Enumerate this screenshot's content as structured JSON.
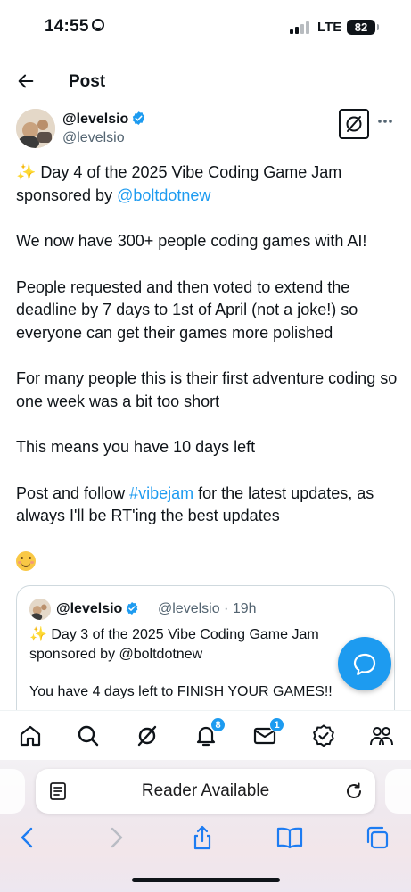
{
  "status_bar": {
    "time": "14:55",
    "network": "LTE",
    "battery": "82"
  },
  "header": {
    "title": "Post"
  },
  "author": {
    "name": "@levelsio",
    "handle": "@levelsio"
  },
  "post": {
    "line1_text": " Day 4 of the 2025 Vibe Coding Game Jam",
    "line2_prefix": "sponsored by ",
    "line2_link": "@boltdotnew",
    "p2": "We now have 300+ people coding games with AI!",
    "p3": "People requested and then voted to extend the deadline by 7 days to 1st of April (not a joke!) so everyone can get their games more polished",
    "p4": "For many people this is their first adventure coding so one week was a bit too short",
    "p5": "This means you have 10 days left",
    "p6_prefix": "Post and follow ",
    "p6_link": "#vibejam",
    "p6_suffix": " for the latest updates, as always I'll be RT'ing the best updates"
  },
  "quote": {
    "name": "@levelsio",
    "meta": "@levelsio · 19h",
    "line1": " Day 3 of the 2025 Vibe Coding Game Jam",
    "line2": "sponsored by @boltdotnew",
    "p2": "You have 4 days left to FINISH YOUR GAMES!!"
  },
  "nav": {
    "notifications_badge": "8",
    "messages_badge": "1"
  },
  "browser": {
    "address_text": "Reader Available"
  },
  "colors": {
    "accent": "#1d9bf0",
    "text": "#0f1419",
    "secondary": "#536471"
  },
  "icons": [
    "back-arrow-icon",
    "verified-icon",
    "grok-icon",
    "more-icon",
    "sparkles-icon",
    "smile-emoji-icon",
    "compose-reply-icon",
    "home-icon",
    "search-icon",
    "grok-icon",
    "bell-icon",
    "mail-icon",
    "verified-orgs-icon",
    "communities-icon",
    "reader-icon",
    "reload-icon",
    "back-chevron-icon",
    "forward-chevron-icon",
    "share-icon",
    "bookmarks-icon",
    "tabs-icon"
  ]
}
